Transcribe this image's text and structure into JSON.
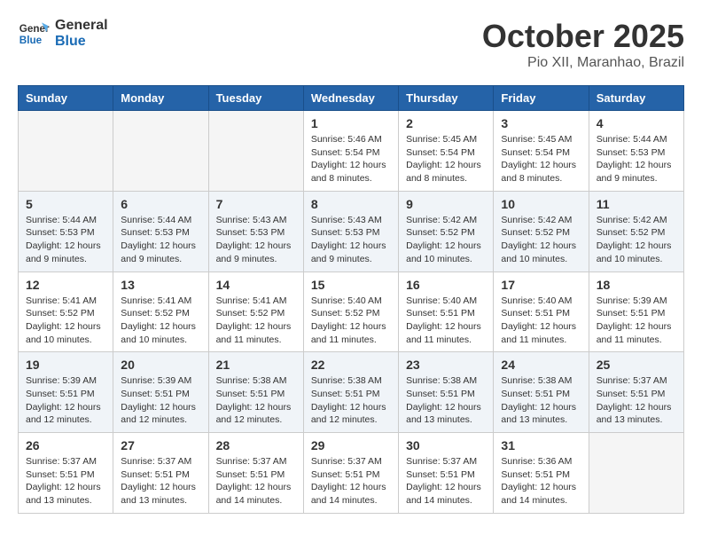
{
  "logo": {
    "text_general": "General",
    "text_blue": "Blue"
  },
  "title": "October 2025",
  "location": "Pio XII, Maranhao, Brazil",
  "weekdays": [
    "Sunday",
    "Monday",
    "Tuesday",
    "Wednesday",
    "Thursday",
    "Friday",
    "Saturday"
  ],
  "weeks": [
    [
      {
        "day": "",
        "info": ""
      },
      {
        "day": "",
        "info": ""
      },
      {
        "day": "",
        "info": ""
      },
      {
        "day": "1",
        "info": "Sunrise: 5:46 AM\nSunset: 5:54 PM\nDaylight: 12 hours\nand 8 minutes."
      },
      {
        "day": "2",
        "info": "Sunrise: 5:45 AM\nSunset: 5:54 PM\nDaylight: 12 hours\nand 8 minutes."
      },
      {
        "day": "3",
        "info": "Sunrise: 5:45 AM\nSunset: 5:54 PM\nDaylight: 12 hours\nand 8 minutes."
      },
      {
        "day": "4",
        "info": "Sunrise: 5:44 AM\nSunset: 5:53 PM\nDaylight: 12 hours\nand 9 minutes."
      }
    ],
    [
      {
        "day": "5",
        "info": "Sunrise: 5:44 AM\nSunset: 5:53 PM\nDaylight: 12 hours\nand 9 minutes."
      },
      {
        "day": "6",
        "info": "Sunrise: 5:44 AM\nSunset: 5:53 PM\nDaylight: 12 hours\nand 9 minutes."
      },
      {
        "day": "7",
        "info": "Sunrise: 5:43 AM\nSunset: 5:53 PM\nDaylight: 12 hours\nand 9 minutes."
      },
      {
        "day": "8",
        "info": "Sunrise: 5:43 AM\nSunset: 5:53 PM\nDaylight: 12 hours\nand 9 minutes."
      },
      {
        "day": "9",
        "info": "Sunrise: 5:42 AM\nSunset: 5:52 PM\nDaylight: 12 hours\nand 10 minutes."
      },
      {
        "day": "10",
        "info": "Sunrise: 5:42 AM\nSunset: 5:52 PM\nDaylight: 12 hours\nand 10 minutes."
      },
      {
        "day": "11",
        "info": "Sunrise: 5:42 AM\nSunset: 5:52 PM\nDaylight: 12 hours\nand 10 minutes."
      }
    ],
    [
      {
        "day": "12",
        "info": "Sunrise: 5:41 AM\nSunset: 5:52 PM\nDaylight: 12 hours\nand 10 minutes."
      },
      {
        "day": "13",
        "info": "Sunrise: 5:41 AM\nSunset: 5:52 PM\nDaylight: 12 hours\nand 10 minutes."
      },
      {
        "day": "14",
        "info": "Sunrise: 5:41 AM\nSunset: 5:52 PM\nDaylight: 12 hours\nand 11 minutes."
      },
      {
        "day": "15",
        "info": "Sunrise: 5:40 AM\nSunset: 5:52 PM\nDaylight: 12 hours\nand 11 minutes."
      },
      {
        "day": "16",
        "info": "Sunrise: 5:40 AM\nSunset: 5:51 PM\nDaylight: 12 hours\nand 11 minutes."
      },
      {
        "day": "17",
        "info": "Sunrise: 5:40 AM\nSunset: 5:51 PM\nDaylight: 12 hours\nand 11 minutes."
      },
      {
        "day": "18",
        "info": "Sunrise: 5:39 AM\nSunset: 5:51 PM\nDaylight: 12 hours\nand 11 minutes."
      }
    ],
    [
      {
        "day": "19",
        "info": "Sunrise: 5:39 AM\nSunset: 5:51 PM\nDaylight: 12 hours\nand 12 minutes."
      },
      {
        "day": "20",
        "info": "Sunrise: 5:39 AM\nSunset: 5:51 PM\nDaylight: 12 hours\nand 12 minutes."
      },
      {
        "day": "21",
        "info": "Sunrise: 5:38 AM\nSunset: 5:51 PM\nDaylight: 12 hours\nand 12 minutes."
      },
      {
        "day": "22",
        "info": "Sunrise: 5:38 AM\nSunset: 5:51 PM\nDaylight: 12 hours\nand 12 minutes."
      },
      {
        "day": "23",
        "info": "Sunrise: 5:38 AM\nSunset: 5:51 PM\nDaylight: 12 hours\nand 13 minutes."
      },
      {
        "day": "24",
        "info": "Sunrise: 5:38 AM\nSunset: 5:51 PM\nDaylight: 12 hours\nand 13 minutes."
      },
      {
        "day": "25",
        "info": "Sunrise: 5:37 AM\nSunset: 5:51 PM\nDaylight: 12 hours\nand 13 minutes."
      }
    ],
    [
      {
        "day": "26",
        "info": "Sunrise: 5:37 AM\nSunset: 5:51 PM\nDaylight: 12 hours\nand 13 minutes."
      },
      {
        "day": "27",
        "info": "Sunrise: 5:37 AM\nSunset: 5:51 PM\nDaylight: 12 hours\nand 13 minutes."
      },
      {
        "day": "28",
        "info": "Sunrise: 5:37 AM\nSunset: 5:51 PM\nDaylight: 12 hours\nand 14 minutes."
      },
      {
        "day": "29",
        "info": "Sunrise: 5:37 AM\nSunset: 5:51 PM\nDaylight: 12 hours\nand 14 minutes."
      },
      {
        "day": "30",
        "info": "Sunrise: 5:37 AM\nSunset: 5:51 PM\nDaylight: 12 hours\nand 14 minutes."
      },
      {
        "day": "31",
        "info": "Sunrise: 5:36 AM\nSunset: 5:51 PM\nDaylight: 12 hours\nand 14 minutes."
      },
      {
        "day": "",
        "info": ""
      }
    ]
  ]
}
